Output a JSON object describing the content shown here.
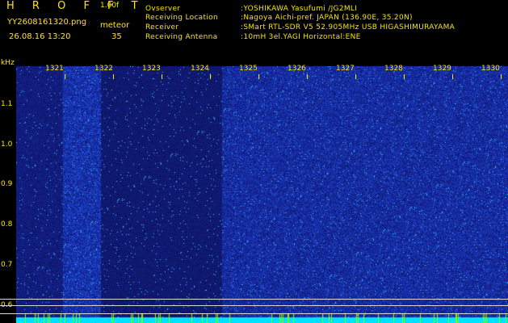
{
  "header": {
    "app_title": "H R O F F T",
    "version": "1.00f",
    "file_name": "YY2608161320.png",
    "timestamp": "26.08.16 13:20",
    "meteor_label": "meteor",
    "meteor_count": "35"
  },
  "info": [
    {
      "label": "Ovserver",
      "value": ":YOSHIKAWA Yasufumi /JG2MLI"
    },
    {
      "label": "Receiving Location",
      "value": ":Nagoya Aichi-pref. JAPAN (136.90E, 35.20N)"
    },
    {
      "label": "Receiver",
      "value": ":SMart RTL-SDR V5 52.905MHz USB HIGASHIMURAYAMA"
    },
    {
      "label": "Receiving Antenna",
      "value": ":10mH 3el.YAGI Horizontal:ENE"
    }
  ],
  "axis": {
    "unit": "kHz",
    "y_ticks": [
      "1.1",
      "1.0",
      "0.9",
      "0.8",
      "0.7",
      "0.6"
    ],
    "minute_labels": [
      "1321",
      "1322",
      "1323",
      "1324",
      "1325",
      "1326",
      "1327",
      "1328",
      "1329",
      "1330"
    ]
  },
  "colors": {
    "text": "#ffe600",
    "background": "#000000",
    "waterfall_base": "#1c2a8c",
    "noise_floor": "#00e5ff"
  }
}
